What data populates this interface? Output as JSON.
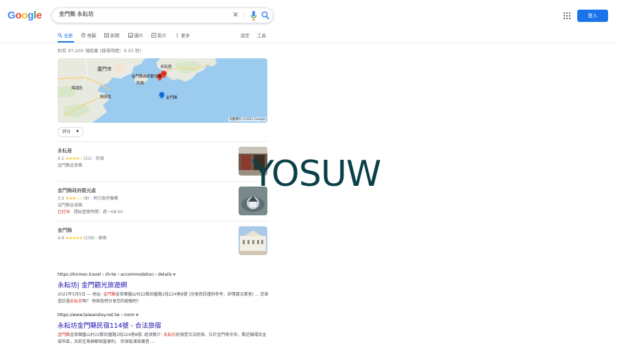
{
  "logo": {
    "letters": [
      "G",
      "o",
      "o",
      "g",
      "l",
      "e"
    ]
  },
  "search": {
    "query": "金門縣 永耘坊"
  },
  "header": {
    "signin_label": "登入"
  },
  "tabs": [
    {
      "label": "全部",
      "icon": "search-icon"
    },
    {
      "label": "地圖",
      "icon": "map-pin-icon"
    },
    {
      "label": "新聞",
      "icon": "news-icon"
    },
    {
      "label": "圖片",
      "icon": "image-icon"
    },
    {
      "label": "影片",
      "icon": "video-icon"
    },
    {
      "label": "更多",
      "icon": "more-vert-icon"
    },
    {
      "label": "設定"
    },
    {
      "label": "工具"
    }
  ],
  "result_stats": "約有 97,200 項結果 (搜尋時間：0.25 秒)",
  "map": {
    "labels": [
      "廈門市",
      "永耘居",
      "金門縣政府觀光處",
      "烈嶼",
      "海滄區",
      "翔安區",
      "金門縣"
    ],
    "credit": "地圖資料 ©2021 Google"
  },
  "rating_filter": {
    "label": "評分",
    "caret": "▼"
  },
  "places": [
    {
      "name": "永耘居",
      "rating": "4.1",
      "stars": "★★★★☆",
      "count": "(21)",
      "category": "民宿",
      "location": "金門縣金寧鄉",
      "closed_label": "",
      "hours": ""
    },
    {
      "name": "金門縣政府觀光處",
      "rating": "3.5",
      "stars": "★★★☆☆",
      "count": "(8)",
      "category": "地方政府機構",
      "location": "金門縣金城鎮",
      "closed_label": "已打烊",
      "hours": "開始營業時間：週一08:00"
    },
    {
      "name": "金門縣",
      "rating": "4.6",
      "stars": "★★★★★",
      "count": "(139)",
      "category": "群島",
      "location": "",
      "closed_label": "",
      "hours": ""
    }
  ],
  "watermark": "YOSUW",
  "results": [
    {
      "cite": "https://kinmen.travel › zh-tw › accommodation › details",
      "title": "永耘坊| 金門觀光旅遊網",
      "snippet_parts": [
        {
          "t": "2021年5月5日 — 地址: "
        },
        {
          "t": "金門縣",
          "hl": true
        },
        {
          "t": "金寧鄉盤山村22鄰后盤路2段224巷8號 (住宿資訊僅供參考，詳情請洽業者) ... 您曾造訪過"
        },
        {
          "t": "永耘坊",
          "hl": true
        },
        {
          "t": "嗎？ 快與我們分享您的經驗吧！"
        }
      ]
    },
    {
      "cite": "https://www.taiwanstay.net.tw › room",
      "title": "永耘坊金門縣民宿114號 - 合法旅宿",
      "snippet_parts": [
        {
          "t": "金門縣",
          "hl": true
        },
        {
          "t": "金寧鄉盤山村22鄰后盤路2段224巷8號. 經濟簡介: "
        },
        {
          "t": "永耘坊",
          "hl": true
        },
        {
          "t": "民宿是合法民宿，位於金門島中央，鄰近機場及金城市區，且前往島嶼都相當便利。 民宿裝潢設備皆 ..."
        }
      ]
    }
  ],
  "colors": {
    "accent": "#1a73e8",
    "link": "#1a0dab",
    "highlight": "#d93025",
    "star": "#fbbc04"
  }
}
